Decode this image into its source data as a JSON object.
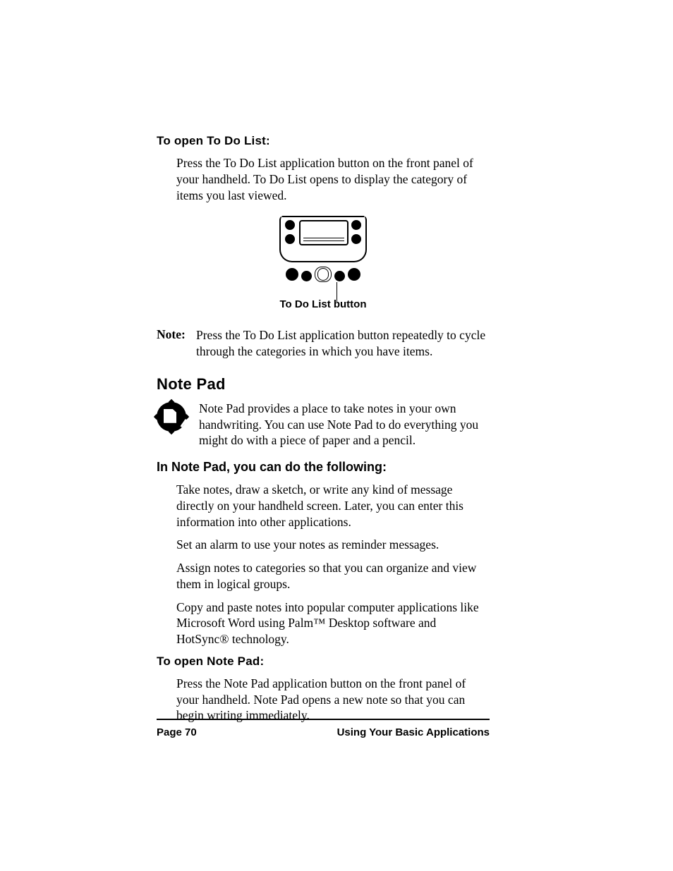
{
  "headings": {
    "to_open_todo": "To open To Do List:",
    "note_pad": "Note Pad",
    "in_note_pad": "In Note Pad, you can do the following:",
    "to_open_notepad": "To open Note Pad:"
  },
  "paragraphs": {
    "open_todo_body": "Press the To Do List application button on the front panel of your handheld. To Do List opens to display the category of items you last viewed.",
    "figure_caption": "To Do List button",
    "note_label": "Note:",
    "note_body": "Press the To Do List application button repeatedly to cycle through the categories in which you have items.",
    "notepad_intro": "Note Pad provides a place to take notes in your own handwriting. You can use Note Pad to do everything you might do with a piece of paper and a pencil.",
    "open_notepad_body": "Press the Note Pad application button on the front panel of your handheld. Note Pad opens a new note so that you can begin writing immediately."
  },
  "features": {
    "f1": "Take notes, draw a sketch, or write any kind of message directly on your handheld screen. Later, you can enter this information into other applications.",
    "f2": "Set an alarm to use your notes as reminder messages.",
    "f3": "Assign notes to categories so that you can organize and view them in logical groups.",
    "f4": "Copy and paste notes into popular computer applications like Microsoft Word using Palm™ Desktop software and HotSync® technology."
  },
  "footer": {
    "page": "Page 70",
    "chapter": "Using Your Basic Applications"
  }
}
